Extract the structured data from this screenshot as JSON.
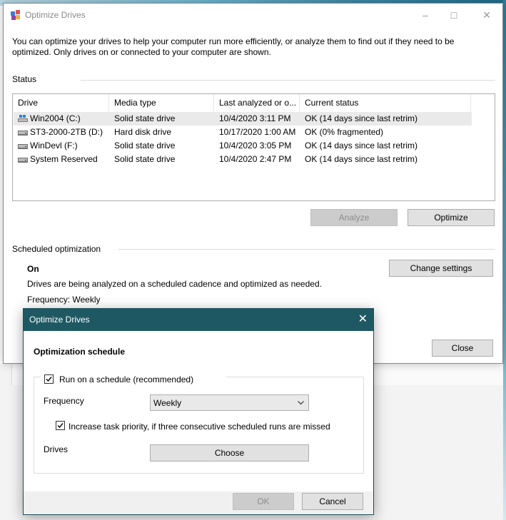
{
  "window": {
    "title": "Optimize Drives",
    "intro": "You can optimize your drives to help your computer run more efficiently, or analyze them to find out if they need to be optimized. Only drives on or connected to your computer are shown.",
    "status_label": "Status",
    "columns": [
      "Drive",
      "Media type",
      "Last analyzed or o...",
      "Current status"
    ],
    "drives": [
      {
        "name": "Win2004 (C:)",
        "media": "Solid state drive",
        "last": "10/4/2020 3:11 PM",
        "status": "OK (14 days since last retrim)",
        "icon": "windows-drive-icon"
      },
      {
        "name": "ST3-2000-2TB (D:)",
        "media": "Hard disk drive",
        "last": "10/17/2020 1:00 AM",
        "status": "OK (0% fragmented)",
        "icon": "drive-icon"
      },
      {
        "name": "WinDevl (F:)",
        "media": "Solid state drive",
        "last": "10/4/2020 3:05 PM",
        "status": "OK (14 days since last retrim)",
        "icon": "drive-icon"
      },
      {
        "name": "System Reserved",
        "media": "Solid state drive",
        "last": "10/4/2020 2:47 PM",
        "status": "OK (14 days since last retrim)",
        "icon": "drive-icon"
      }
    ],
    "analyze_label": "Analyze",
    "optimize_label": "Optimize",
    "scheduled_label": "Scheduled optimization",
    "scheduled_state": "On",
    "scheduled_desc": "Drives are being analyzed on a scheduled cadence and optimized as needed.",
    "frequency_text": "Frequency: Weekly",
    "change_settings_label": "Change settings",
    "close_label": "Close"
  },
  "dialog": {
    "title": "Optimize Drives",
    "heading": "Optimization schedule",
    "run_schedule_label": "Run on a schedule (recommended)",
    "run_schedule_checked": true,
    "frequency_label": "Frequency",
    "frequency_value": "Weekly",
    "priority_label": "Increase task priority, if three consecutive scheduled runs are missed",
    "priority_checked": true,
    "drives_label": "Drives",
    "choose_label": "Choose",
    "ok_label": "OK",
    "cancel_label": "Cancel"
  },
  "colors": {
    "dialog_titlebar": "#1e5963",
    "selection": "#eaeaea",
    "accent": "#0078d7"
  }
}
